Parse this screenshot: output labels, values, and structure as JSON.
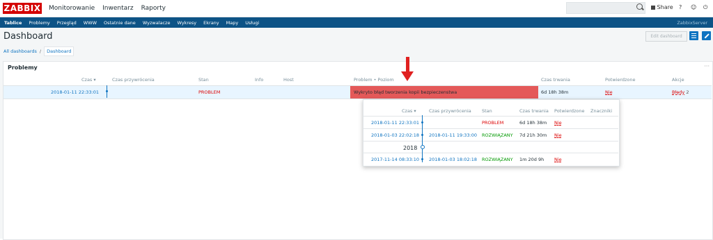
{
  "topbar": {
    "logo": "ZABBIX",
    "menu": [
      "Monitorowanie",
      "Inwentarz",
      "Raporty"
    ],
    "share_label": "Share",
    "help": "?",
    "user": "☺",
    "logout": "⏻"
  },
  "submenu": {
    "items": [
      "Tablice",
      "Problemy",
      "Przegląd",
      "WWW",
      "Ostatnie dane",
      "Wyzwalacze",
      "Wykresy",
      "Ekrany",
      "Mapy",
      "Usługi"
    ],
    "server": "ZabbixServer"
  },
  "header": {
    "title": "Dashboard",
    "edit_button": "Edit dashboard"
  },
  "breadcrumb": {
    "all": "All dashboards",
    "separator": "/",
    "current": "Dashboard"
  },
  "widget": {
    "title": "Problemy",
    "menu": "···",
    "columns": {
      "time": "Czas ▾",
      "recovery": "Czas przywrócenia",
      "status": "Stan",
      "info": "Info",
      "host": "Host",
      "problem": "Problem • Poziom",
      "duration": "Czas trwania",
      "ack": "Potwierdzone",
      "actions": "Akcje"
    },
    "row": {
      "time": "2018-01-11 22:33:01",
      "status": "PROBLEM",
      "problem": "Wykryto błąd tworzenia kopii bezpieczenstwa",
      "duration": "6d 18h 38m",
      "ack": "Nie",
      "actions": "Błędy",
      "actions_count": "2"
    }
  },
  "popup": {
    "columns": {
      "time": "Czas ▾",
      "recovery": "Czas przywrócenia",
      "status": "Stan",
      "duration": "Czas trwania",
      "ack": "Potwierdzone",
      "tags": "Znaczniki"
    },
    "rows": [
      {
        "time": "2018-01-11 22:33:01",
        "recovery": "",
        "status": "PROBLEM",
        "duration": "6d 18h 38m",
        "ack": "Nie"
      },
      {
        "time": "2018-01-03 22:02:18",
        "recovery": "2018-01-11 19:33:00",
        "status": "ROZWIĄZANY",
        "duration": "7d 21h 30m",
        "ack": "Nie"
      },
      {
        "year": "2018"
      },
      {
        "time": "2017-11-14 08:33:10",
        "recovery": "2018-01-03 18:02:18",
        "status": "ROZWIĄZANY",
        "duration": "1m 20d 9h",
        "ack": "Nie"
      }
    ]
  },
  "colors": {
    "brand": "#d40000",
    "nav": "#0d5386",
    "link": "#0f74c1",
    "problem_bg": "#e45959",
    "problem_text": "#dc0000",
    "resolved_text": "#009900"
  }
}
